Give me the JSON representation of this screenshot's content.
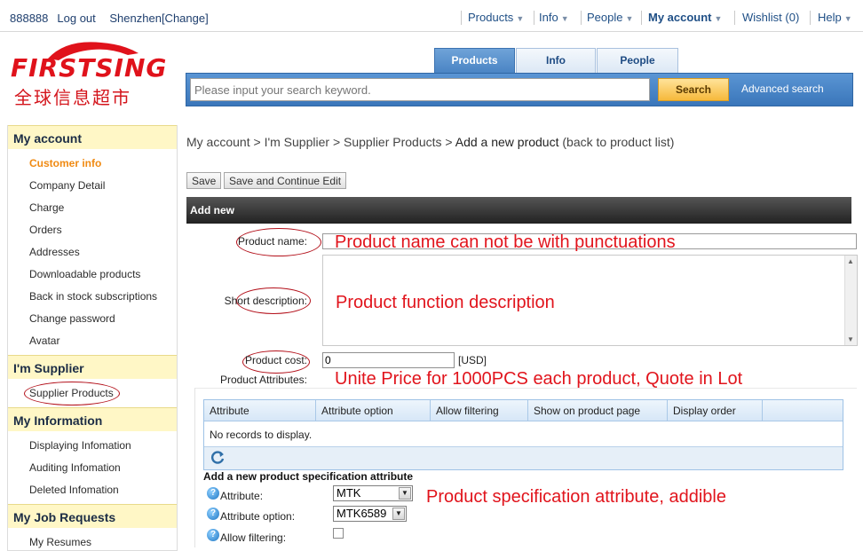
{
  "topbar": {
    "user": "888888",
    "logout": "Log out",
    "location": "Shenzhen[Change]",
    "nav": {
      "products": "Products",
      "info": "Info",
      "people": "People",
      "my_account": "My account",
      "wishlist": "Wishlist (0)",
      "help": "Help"
    }
  },
  "logo": {
    "latin": "FIRSTSING",
    "chinese": "全球信息超市"
  },
  "search": {
    "tabs": [
      "Products",
      "Info",
      "People"
    ],
    "active_tab": "Products",
    "placeholder": "Please input your search keyword.",
    "button": "Search",
    "advanced": "Advanced search"
  },
  "sidebar": {
    "sections": [
      {
        "title": "My account",
        "items": [
          "Customer info",
          "Company Detail",
          "Charge",
          "Orders",
          "Addresses",
          "Downloadable products",
          "Back in stock subscriptions",
          "Change password",
          "Avatar"
        ]
      },
      {
        "title": "I'm Supplier",
        "items": [
          "Supplier Products"
        ]
      },
      {
        "title": "My Information",
        "items": [
          "Displaying Infomation",
          "Auditing Infomation",
          "Deleted Infomation"
        ]
      },
      {
        "title": "My Job Requests",
        "items": [
          "My Resumes"
        ]
      }
    ]
  },
  "breadcrumb": {
    "part1": "My account",
    "part2": "I'm Supplier",
    "part3": "Supplier Products",
    "current": "Add a new product",
    "back": "(back to product list)",
    "sep": ">"
  },
  "buttons": {
    "save": "Save",
    "save_continue": "Save and Continue Edit"
  },
  "section_title": "Add new",
  "form": {
    "product_name_label": "Product name:",
    "short_desc_label": "Short description:",
    "cost_label": "Product cost:",
    "cost_value": "0",
    "cost_unit": "[USD]",
    "attributes_label": "Product Attributes:"
  },
  "notes": {
    "name": "Product name can not be with punctuations",
    "desc": "Product function description",
    "cost": "Unite Price for 1000PCS each product, Quote in Lot",
    "spec": "Product specification attribute, addible"
  },
  "grid": {
    "columns": [
      "Attribute",
      "Attribute option",
      "Allow filtering",
      "Show on product page",
      "Display order"
    ],
    "empty": "No records to display."
  },
  "spec": {
    "title": "Add a new product specification attribute",
    "attribute_label": "Attribute:",
    "attribute_value": "MTK",
    "option_label": "Attribute option:",
    "option_value": "MTK6589",
    "filter_label": "Allow filtering:"
  },
  "icons": {
    "refresh": "refresh-icon",
    "help": "help-icon",
    "dropdown": "chevron-down-icon"
  },
  "colors": {
    "annotation_red": "#e1141c",
    "sidebar_header": "#fff7c6",
    "active_link": "#f08a12",
    "search_blue": "#3a76ba"
  }
}
